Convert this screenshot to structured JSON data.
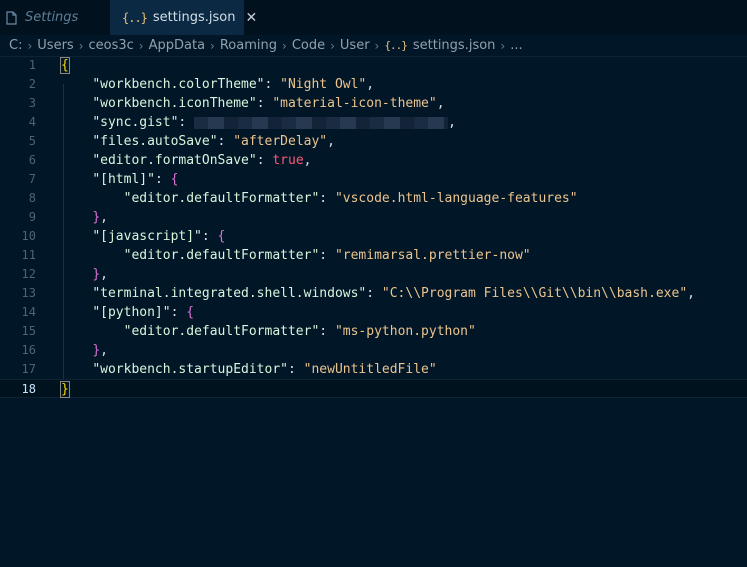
{
  "tabs": [
    {
      "label": "Settings"
    },
    {
      "label": "settings.json",
      "icon": "{..}"
    }
  ],
  "breadcrumbs": [
    "C:",
    "Users",
    "ceos3c",
    "AppData",
    "Roaming",
    "Code",
    "User",
    "settings.json",
    "..."
  ],
  "breadcrumb_icon": "{..}",
  "editor": {
    "line_numbers": [
      "1",
      "2",
      "3",
      "4",
      "5",
      "6",
      "7",
      "8",
      "9",
      "10",
      "11",
      "12",
      "13",
      "14",
      "15",
      "16",
      "17",
      "18"
    ],
    "lines": [
      {
        "k": "",
        "v": ""
      },
      {
        "k": "\"workbench.colorTheme\"",
        "v": "\"Night Owl\""
      },
      {
        "k": "\"workbench.iconTheme\"",
        "v": "\"material-icon-theme\""
      },
      {
        "k": "\"sync.gist\"",
        "v": ""
      },
      {
        "k": "\"files.autoSave\"",
        "v": "\"afterDelay\""
      },
      {
        "k": "\"editor.formatOnSave\"",
        "v": "true"
      },
      {
        "k": "\"[html]\"",
        "v": "{"
      },
      {
        "k": "\"editor.defaultFormatter\"",
        "v": "\"vscode.html-language-features\""
      },
      {
        "k": "}",
        "v": ""
      },
      {
        "k": "\"[javascript]\"",
        "v": "{"
      },
      {
        "k": "\"editor.defaultFormatter\"",
        "v": "\"remimarsal.prettier-now\""
      },
      {
        "k": "}",
        "v": ""
      },
      {
        "k": "\"terminal.integrated.shell.windows\"",
        "v": "\"C:\\\\Program Files\\\\Git\\\\bin\\\\bash.exe\""
      },
      {
        "k": "\"[python]\"",
        "v": "{"
      },
      {
        "k": "\"editor.defaultFormatter\"",
        "v": "\"ms-python.python\""
      },
      {
        "k": "}",
        "v": ""
      },
      {
        "k": "\"workbench.startupEditor\"",
        "v": "\"newUntitledFile\""
      },
      {
        "k": "}",
        "v": ""
      }
    ],
    "open_brace": "{",
    "close_brace": "}"
  },
  "colors": {
    "background": "#011627",
    "string": "#ecc48d",
    "key": "#d9f5dd",
    "boolean": "#ff5874",
    "bracket": "#ffd700"
  }
}
